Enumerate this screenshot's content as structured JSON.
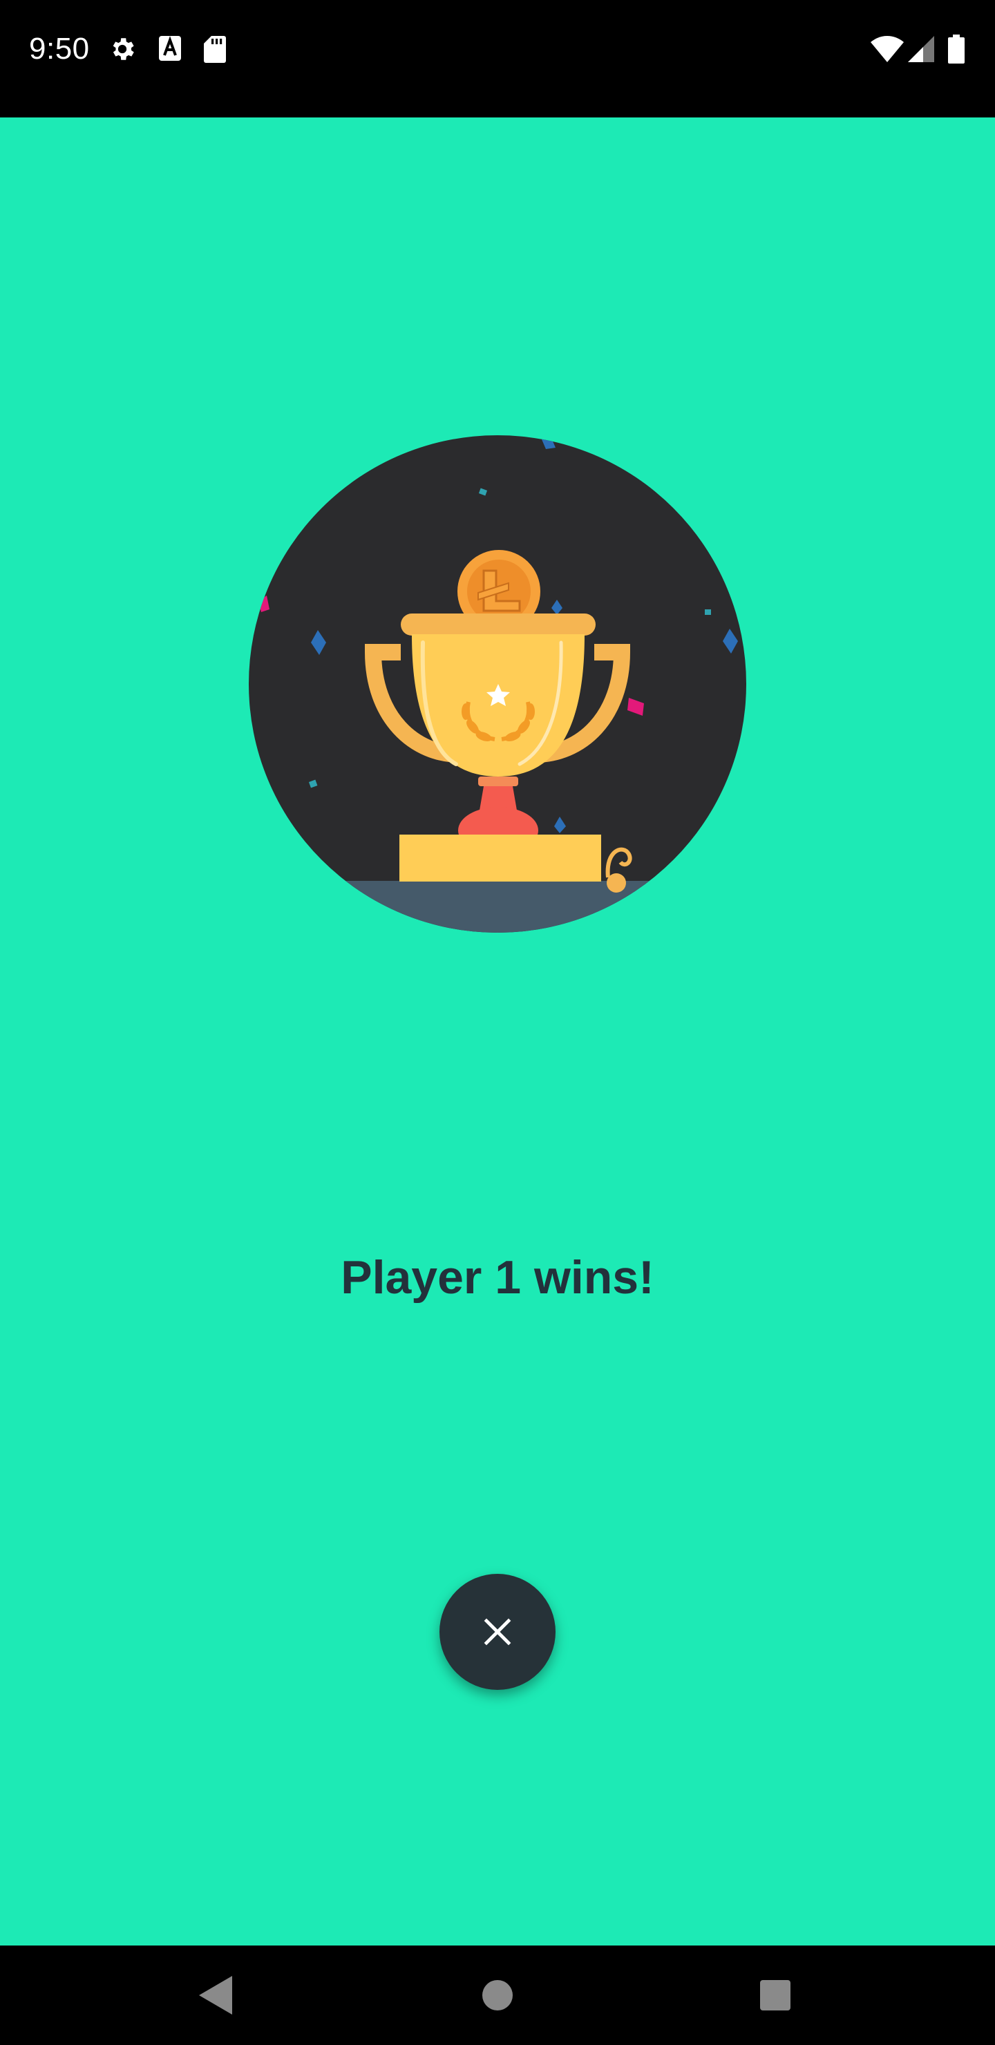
{
  "status_bar": {
    "time": "9:50",
    "left_icons": [
      "gear-icon",
      "font-a-icon",
      "sd-card-icon"
    ],
    "right_icons": [
      "wifi-icon",
      "cell-signal-icon",
      "battery-icon"
    ]
  },
  "game_over": {
    "result_text": "Player 1 wins!",
    "illustration": "trophy-with-coin-icon",
    "close_icon": "close-icon"
  },
  "navigation_bar": {
    "buttons": [
      "back-icon",
      "home-icon",
      "recents-icon"
    ]
  },
  "colors": {
    "background": "#1DEAB5",
    "text": "#23313B",
    "fab": "#263238",
    "trophy": "#FFCD56",
    "circle": "#2B2B2D"
  }
}
